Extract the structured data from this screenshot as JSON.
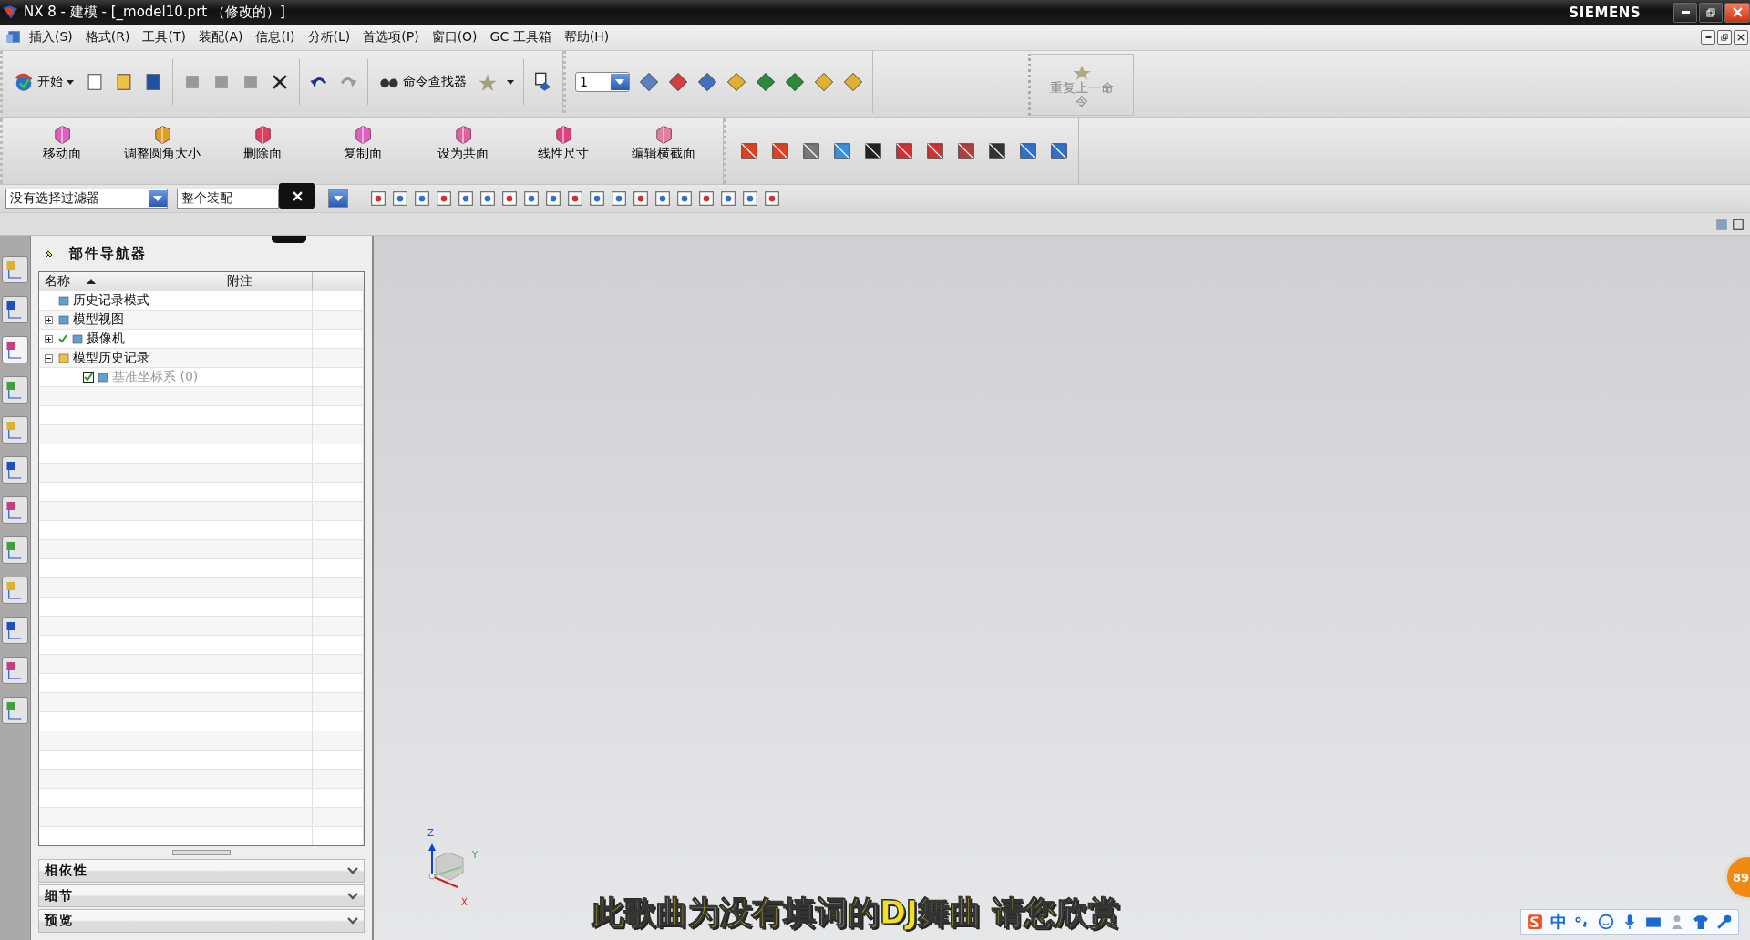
{
  "window": {
    "title": "NX 8 - 建模 - [_model10.prt （修改的）]",
    "brand": "SIEMENS"
  },
  "menu": [
    "插入(S)",
    "格式(R)",
    "工具(T)",
    "装配(A)",
    "信息(I)",
    "分析(L)",
    "首选项(P)",
    "窗口(O)",
    "GC 工具箱",
    "帮助(H)"
  ],
  "standard_toolbar": {
    "start_label": "开始",
    "command_finder": "命令查找器",
    "layer_value": "1"
  },
  "repeat_command": {
    "label": "重复上一命令",
    "disabled": true
  },
  "feature_toolbar": [
    "移动面",
    "调整圆角大小",
    "删除面",
    "复制面",
    "设为共面",
    "线性尺寸",
    "编辑横截面"
  ],
  "selection_bar": {
    "filter": "没有选择过滤器",
    "scope": "整个装配"
  },
  "navigator": {
    "title": "部件导航器",
    "columns": [
      "名称",
      "附注"
    ],
    "tree": [
      {
        "label": "历史记录模式",
        "checked": false,
        "disabled": false
      },
      {
        "label": "模型视图",
        "expanded": false,
        "checked": false,
        "disabled": false
      },
      {
        "label": "摄像机",
        "expanded": false,
        "checked": true,
        "disabled": false
      },
      {
        "label": "模型历史记录",
        "expanded": true,
        "checked": false,
        "disabled": false,
        "children": [
          {
            "label": "基准坐标系 (0)",
            "checked": true,
            "disabled": true
          }
        ]
      }
    ]
  },
  "panels": [
    {
      "title": "相依性",
      "expanded": false
    },
    {
      "title": "细节",
      "expanded": false
    },
    {
      "title": "预览",
      "expanded": false
    }
  ],
  "triad": {
    "axes": [
      "Z",
      "Y",
      "X"
    ]
  },
  "subtitle": "此歌曲为没有填词的DJ舞曲 请您欣赏",
  "ime_toolbar": {
    "mode": "中"
  },
  "badge": "89"
}
